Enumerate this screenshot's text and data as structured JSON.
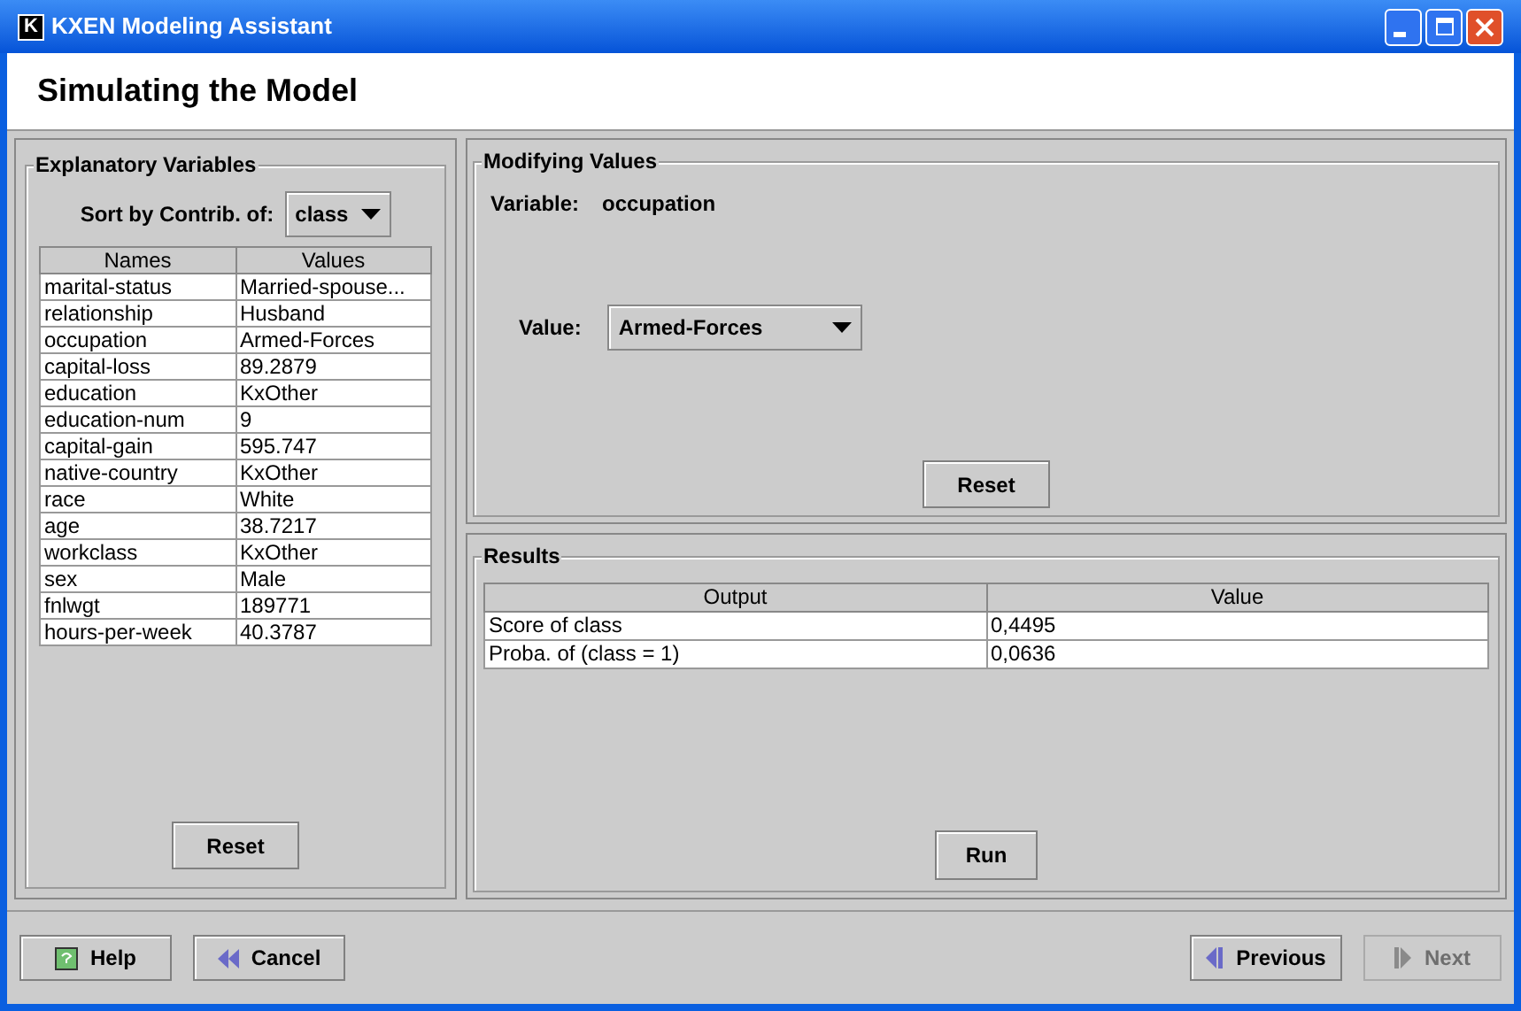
{
  "window": {
    "icon": "K",
    "title": "KXEN Modeling Assistant"
  },
  "header": {
    "title": "Simulating the Model"
  },
  "explanatory_variables": {
    "title": "Explanatory Variables",
    "sort_label": "Sort by Contrib. of:",
    "sort_value": "class",
    "columns": [
      "Names",
      "Values"
    ],
    "rows": [
      [
        "marital-status",
        "Married-spouse..."
      ],
      [
        "relationship",
        "Husband"
      ],
      [
        "occupation",
        "Armed-Forces"
      ],
      [
        "capital-loss",
        "89.2879"
      ],
      [
        "education",
        "KxOther"
      ],
      [
        "education-num",
        "9"
      ],
      [
        "capital-gain",
        "595.747"
      ],
      [
        "native-country",
        "KxOther"
      ],
      [
        "race",
        "White"
      ],
      [
        "age",
        "38.7217"
      ],
      [
        "workclass",
        "KxOther"
      ],
      [
        "sex",
        "Male"
      ],
      [
        "fnlwgt",
        "189771"
      ],
      [
        "hours-per-week",
        "40.3787"
      ]
    ],
    "reset": "Reset"
  },
  "modifying_values": {
    "title": "Modifying Values",
    "variable_label": "Variable:",
    "variable_value": "occupation",
    "value_label": "Value:",
    "value": "Armed-Forces",
    "reset": "Reset"
  },
  "results": {
    "title": "Results",
    "columns": [
      "Output",
      "Value"
    ],
    "rows": [
      [
        "Score of class",
        "0,4495"
      ],
      [
        "Proba. of (class = 1)",
        "0,0636"
      ]
    ],
    "run": "Run"
  },
  "footer": {
    "buttons": [
      {
        "kind": "help",
        "label": "Help",
        "disabled": false
      },
      {
        "kind": "cancel",
        "label": "Cancel",
        "disabled": false
      },
      {
        "kind": "previous",
        "label": "Previous",
        "disabled": false
      },
      {
        "kind": "next",
        "label": "Next",
        "disabled": true
      }
    ]
  }
}
